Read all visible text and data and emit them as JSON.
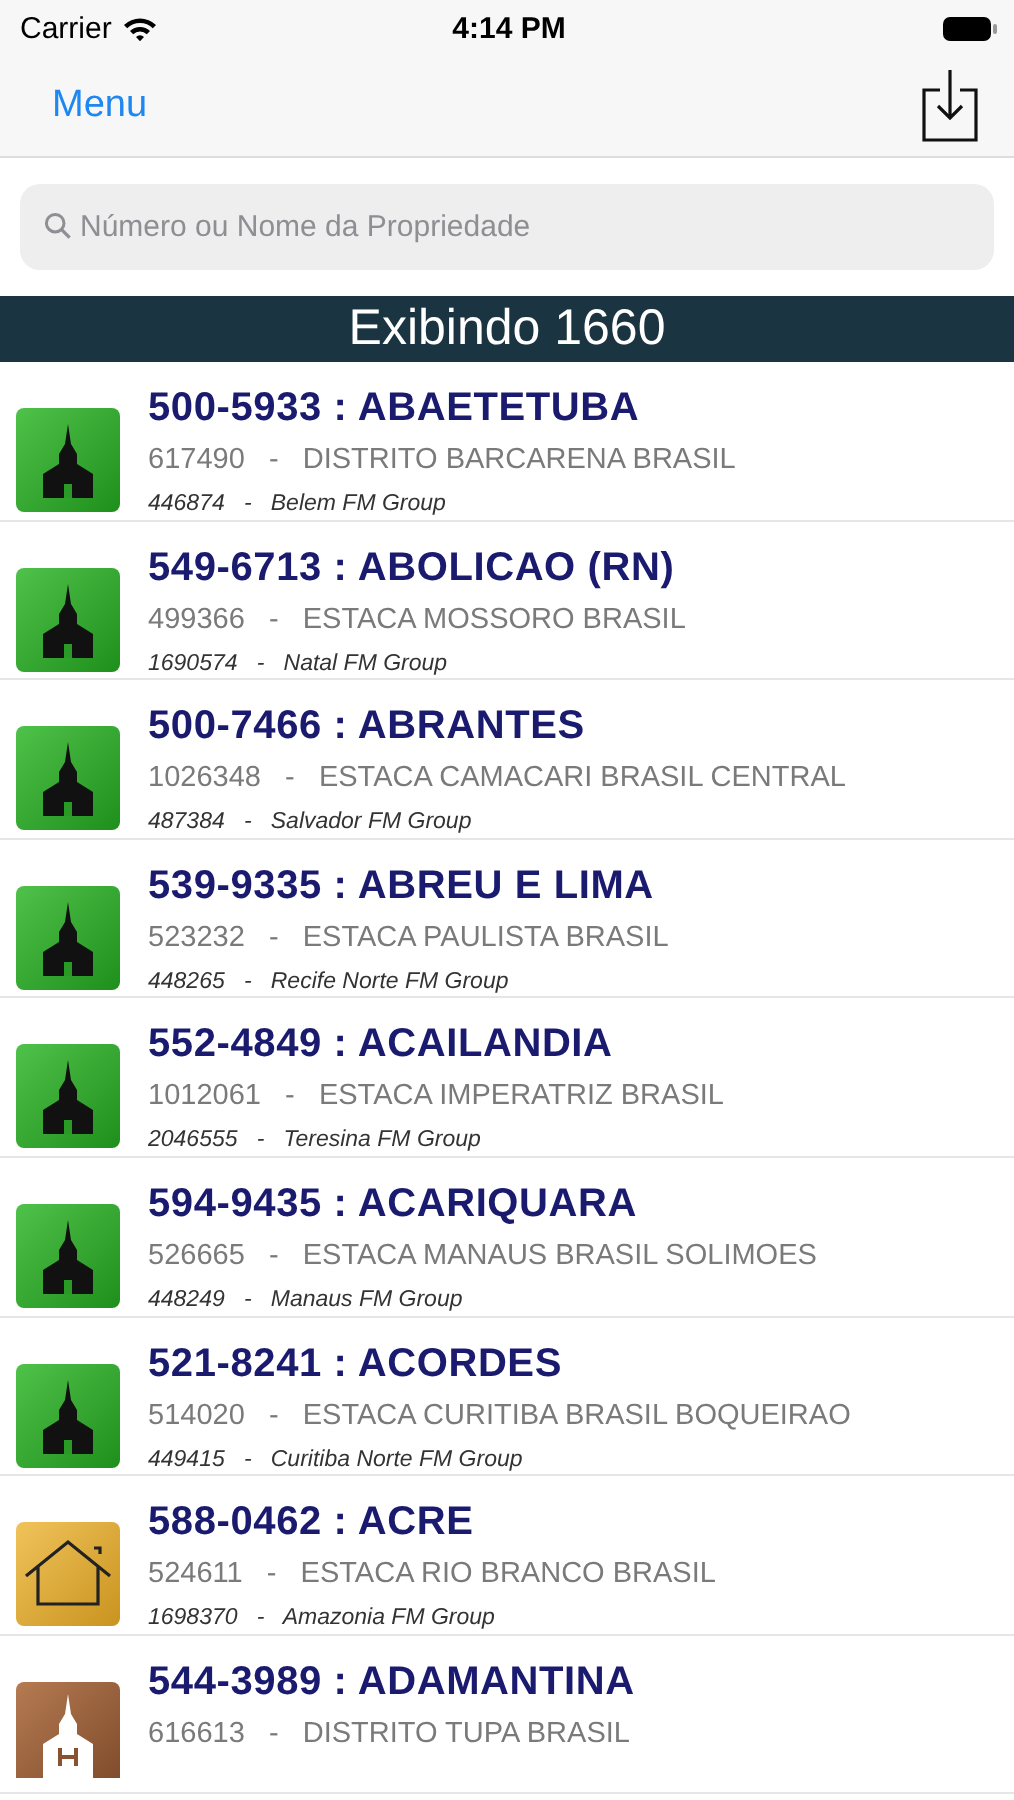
{
  "status_bar": {
    "carrier": "Carrier",
    "time": "4:14 PM"
  },
  "nav": {
    "menu": "Menu"
  },
  "search": {
    "placeholder": "Número ou Nome da Propriedade"
  },
  "header": "Exibindo 1660",
  "rows": [
    {
      "kind": "chapel",
      "title": "500-5933 : ABAETETUBA",
      "unit": "617490   -   DISTRITO BARCARENA BRASIL",
      "group": "446874   -   Belem FM Group"
    },
    {
      "kind": "chapel",
      "title": "549-6713 : ABOLICAO (RN)",
      "unit": "499366   -   ESTACA MOSSORO BRASIL",
      "group": "1690574   -   Natal FM Group"
    },
    {
      "kind": "chapel",
      "title": "500-7466 : ABRANTES",
      "unit": "1026348   -   ESTACA CAMACARI BRASIL CENTRAL",
      "group": "487384   -   Salvador FM Group"
    },
    {
      "kind": "chapel",
      "title": "539-9335 : ABREU E LIMA",
      "unit": "523232   -   ESTACA PAULISTA BRASIL",
      "group": "448265   -   Recife Norte FM Group"
    },
    {
      "kind": "chapel",
      "title": "552-4849 : ACAILANDIA",
      "unit": "1012061   -   ESTACA IMPERATRIZ BRASIL",
      "group": "2046555   -   Teresina FM Group"
    },
    {
      "kind": "chapel",
      "title": "594-9435 : ACARIQUARA",
      "unit": "526665   -   ESTACA MANAUS BRASIL SOLIMOES",
      "group": "448249   -   Manaus FM Group"
    },
    {
      "kind": "chapel",
      "title": "521-8241 : ACORDES",
      "unit": "514020   -   ESTACA CURITIBA BRASIL BOQUEIRAO",
      "group": "449415   -   Curitiba Norte FM Group"
    },
    {
      "kind": "house",
      "title": "588-0462 : ACRE",
      "unit": "524611   -   ESTACA RIO BRANCO BRASIL",
      "group": "1698370   -   Amazonia FM Group"
    },
    {
      "kind": "temple",
      "title": "544-3989 : ADAMANTINA",
      "unit": "616613   -   DISTRITO TUPA BRASIL"
    }
  ]
}
